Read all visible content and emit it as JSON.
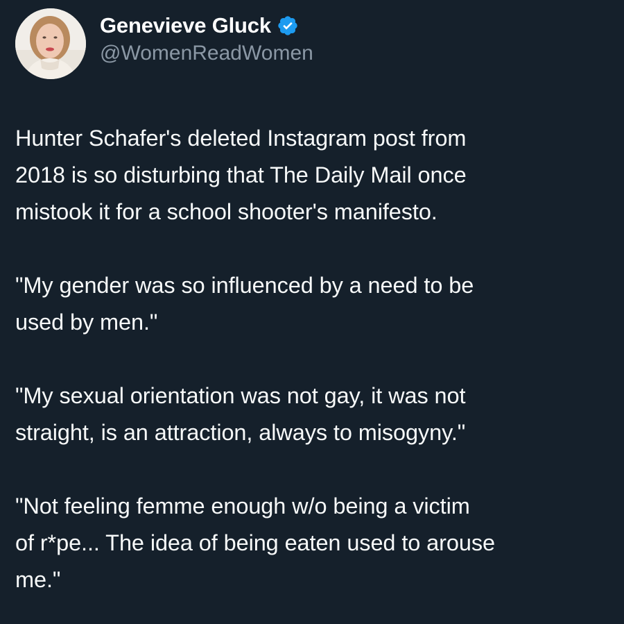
{
  "author": {
    "display_name": "Genevieve Gluck",
    "handle": "@WomenReadWomen",
    "verified_icon": "verified-badge-icon",
    "avatar_icon": "profile-photo"
  },
  "tweet": {
    "paragraphs": [
      "Hunter Schafer's deleted Instagram post from\n2018 is so disturbing that The Daily Mail once\nmistook it for a school shooter's manifesto.",
      "\"My gender was so influenced by a need to be\nused by men.\"",
      "\"My sexual orientation was not gay, it was not\nstraight, is an attraction, always to misogyny.\"",
      "\"Not feeling femme enough w/o being a victim\nof r*pe... The idea of being eaten used to arouse\nme.\""
    ]
  },
  "colors": {
    "background": "#15202b",
    "text": "#f7f9f9",
    "secondary_text": "#8b98a5",
    "verified_blue": "#1d9bf0"
  }
}
